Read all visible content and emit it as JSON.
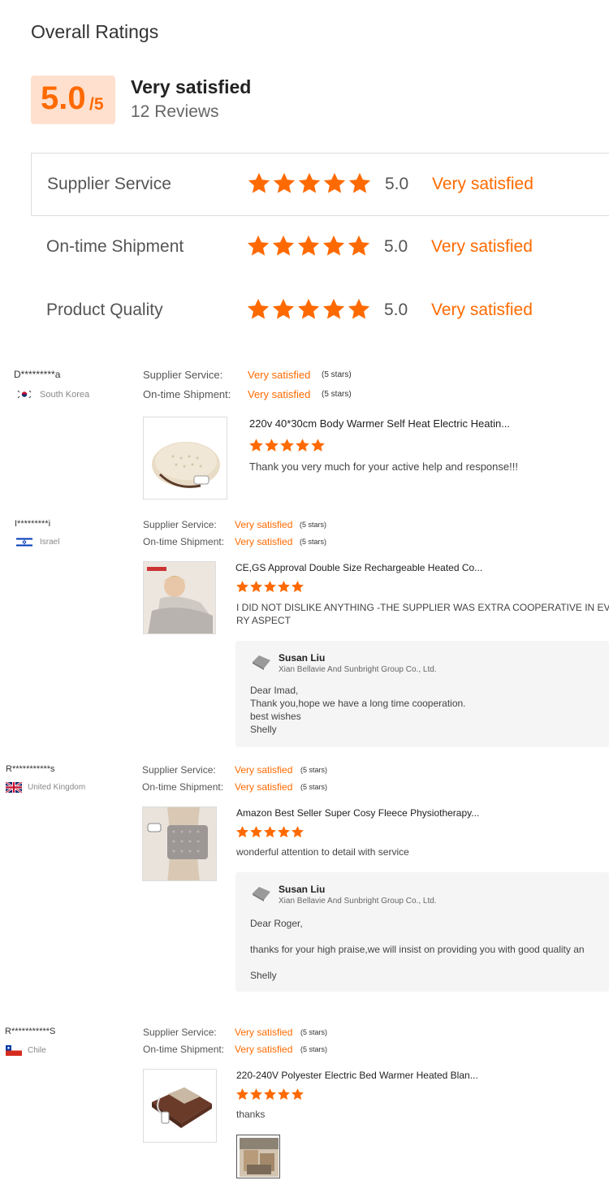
{
  "header": {
    "title": "Overall Ratings",
    "score": "5.0",
    "score_suffix": "/5",
    "label": "Very satisfied",
    "count": "12 Reviews"
  },
  "colors": {
    "accent": "#ff6a00",
    "score_bg": "#ffe0cf",
    "reply_bg": "#f5f5f5"
  },
  "ratings": [
    {
      "label": "Supplier Service",
      "stars": 5,
      "value": "5.0",
      "text": "Very satisfied"
    },
    {
      "label": "On-time Shipment",
      "stars": 5,
      "value": "5.0",
      "text": "Very satisfied"
    },
    {
      "label": "Product Quality",
      "stars": 5,
      "value": "5.0",
      "text": "Very satisfied"
    }
  ],
  "reviews": [
    {
      "buyer": "D*********a",
      "country": "South Korea",
      "flag": "south-korea-flag",
      "service_label": "Supplier Service:",
      "service_value": "Very satisfied",
      "service_stars": "(5 stars)",
      "shipment_label": "On-time Shipment:",
      "shipment_value": "Very satisfied",
      "shipment_stars": "(5 stars)",
      "product_title": "220v 40*30cm Body Warmer Self Heat Electric Heatin...",
      "product_stars": 5,
      "text": "Thank you very much for your active help and response!!!"
    },
    {
      "buyer": "I*********i",
      "country": "Israel",
      "flag": "israel-flag",
      "service_label": "Supplier Service:",
      "service_value": "Very satisfied",
      "service_stars": "(5 stars)",
      "shipment_label": "On-time Shipment:",
      "shipment_value": "Very satisfied",
      "shipment_stars": "(5 stars)",
      "product_title": "CE,GS Approval Double Size Rechargeable Heated Co...",
      "product_stars": 5,
      "text_line1": "I DID NOT DISLIKE ANYTHING -THE SUPPLIER WAS EXTRA COOPERATIVE IN EVE",
      "text_line2": "RY ASPECT",
      "reply": {
        "name": "Susan Liu",
        "company": "Xian Bellavie And Sunbright Group Co., Ltd.",
        "lines": [
          "Dear Imad,",
          "Thank you,hope we have a long time cooperation.",
          "best wishes",
          "Shelly"
        ]
      }
    },
    {
      "buyer": "R***********s",
      "country": "United Kingdom",
      "flag": "united-kingdom-flag",
      "service_label": "Supplier Service:",
      "service_value": "Very satisfied",
      "service_stars": "(5 stars)",
      "shipment_label": "On-time Shipment:",
      "shipment_value": "Very satisfied",
      "shipment_stars": "(5 stars)",
      "product_title": "Amazon Best Seller Super Cosy Fleece Physiotherapy...",
      "product_stars": 5,
      "text": "wonderful attention to detail with service",
      "reply": {
        "name": "Susan Liu",
        "company": "Xian Bellavie And Sunbright Group Co., Ltd.",
        "lines": [
          "Dear Roger,",
          "thanks for your high praise,we will insist on providing you with good quality an",
          "Shelly"
        ]
      }
    },
    {
      "buyer": "R***********S",
      "country": "Chile",
      "flag": "chile-flag",
      "service_label": "Supplier Service:",
      "service_value": "Very satisfied",
      "service_stars": "(5 stars)",
      "shipment_label": "On-time Shipment:",
      "shipment_value": "Very satisfied",
      "shipment_stars": "(5 stars)",
      "product_title": "220-240V Polyester Electric Bed Warmer Heated Blan...",
      "product_stars": 5,
      "text": "thanks"
    }
  ]
}
